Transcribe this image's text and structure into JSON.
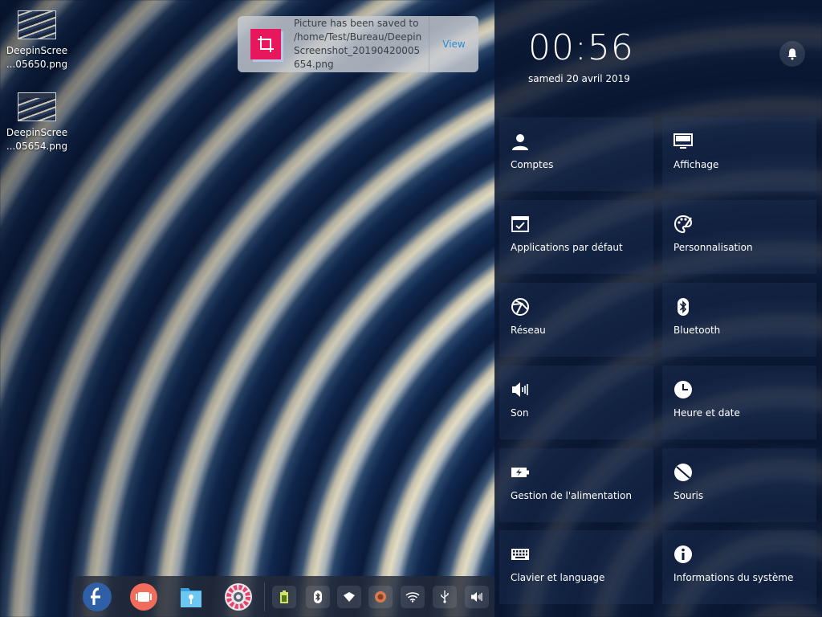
{
  "desktop": {
    "icons": [
      {
        "label_line1": "DeepinScree",
        "label_line2": "...05650.png"
      },
      {
        "label_line1": "DeepinScree",
        "label_line2": "...05654.png"
      }
    ]
  },
  "notification": {
    "message": "Picture has been saved to /home/Test/Bureau/DeepinScreenshot_20190420005654.png",
    "action_label": "View"
  },
  "panel": {
    "time": "00:56",
    "date": "samedi 20 avril 2019",
    "tiles": [
      {
        "label": "Comptes",
        "icon": "user-icon"
      },
      {
        "label": "Affichage",
        "icon": "monitor-icon"
      },
      {
        "label": "Applications par défaut",
        "icon": "default-apps-icon"
      },
      {
        "label": "Personnalisation",
        "icon": "palette-icon"
      },
      {
        "label": "Réseau",
        "icon": "network-icon"
      },
      {
        "label": "Bluetooth",
        "icon": "bluetooth-icon"
      },
      {
        "label": "Son",
        "icon": "speaker-icon"
      },
      {
        "label": "Heure et date",
        "icon": "clock-icon"
      },
      {
        "label": "Gestion de l'alimentation",
        "icon": "battery-icon"
      },
      {
        "label": "Souris",
        "icon": "mouse-icon"
      },
      {
        "label": "Clavier et language",
        "icon": "keyboard-icon"
      },
      {
        "label": "Informations du système",
        "icon": "info-icon"
      }
    ]
  },
  "dock": {
    "apps": [
      "fedora-launcher-icon",
      "multitasking-icon",
      "file-manager-icon",
      "control-center-icon"
    ],
    "tray": [
      "battery-icon",
      "bluetooth-icon",
      "network-icon",
      "sound-app-icon",
      "wifi-icon",
      "usb-icon",
      "volume-icon"
    ]
  },
  "colors": {
    "accent": "#2a8bd8",
    "notification_icon": "#e8175d",
    "panel_bg": "#0a1630"
  }
}
